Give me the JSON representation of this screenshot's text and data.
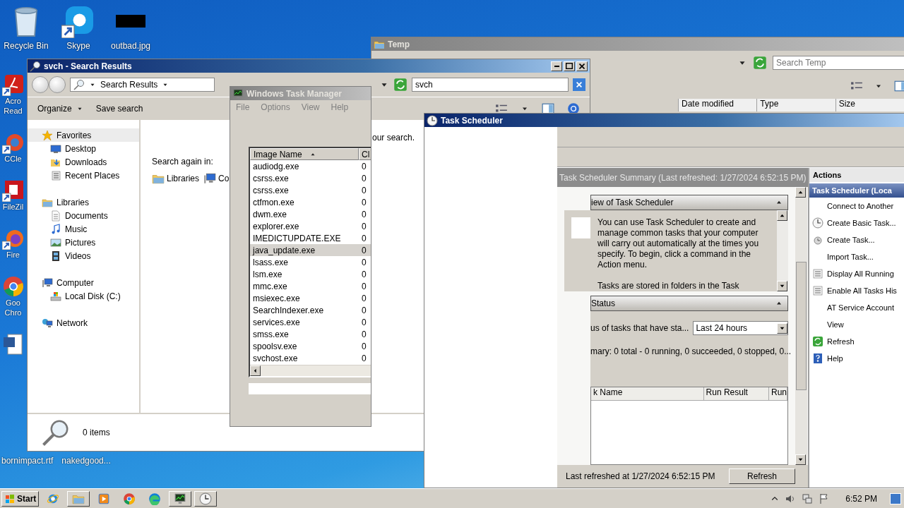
{
  "desktop": {
    "top_icons": [
      {
        "kind": "recycle",
        "label": "Recycle Bin"
      },
      {
        "kind": "app",
        "label": "Skype"
      },
      {
        "kind": "image",
        "label": "outbad.jpg"
      }
    ],
    "side_icons": [
      {
        "kind": "pdf",
        "label": "Acro Read"
      },
      {
        "kind": "ccleaner",
        "label": "CCle"
      },
      {
        "kind": "filezilla",
        "label": "FileZil"
      },
      {
        "kind": "firefox",
        "label": "Fire"
      },
      {
        "kind": "chrome",
        "label": "Goo Chro"
      },
      {
        "kind": "word"
      }
    ],
    "bottom_labels": [
      "bornimpact.rtf",
      "nakedgood..."
    ]
  },
  "temp_window": {
    "title": "Temp",
    "search": {
      "placeholder": "Search Temp"
    },
    "columns": [
      "Date modified",
      "Type",
      "Size"
    ]
  },
  "search_window": {
    "title": "svch - Search Results",
    "address": "Search Results",
    "search": {
      "value": "svch"
    },
    "toolbar": [
      {
        "label": "Organize",
        "menu": true
      },
      {
        "label": "Save search",
        "menu": false
      }
    ],
    "nav": [
      {
        "kind": "star",
        "label": "Favorites",
        "selected": true,
        "children": [
          {
            "kind": "desktop",
            "label": "Desktop",
            "selected": false
          },
          {
            "kind": "download",
            "label": "Downloads",
            "selected": false
          },
          {
            "kind": "recent",
            "label": "Recent Places",
            "selected": false
          }
        ]
      },
      {
        "kind": "library",
        "label": "Libraries",
        "selected": false,
        "children": [
          {
            "kind": "doc",
            "label": "Documents",
            "selected": false
          },
          {
            "kind": "music",
            "label": "Music",
            "selected": false
          },
          {
            "kind": "picture",
            "label": "Pictures",
            "selected": false
          },
          {
            "kind": "video",
            "label": "Videos",
            "selected": false
          }
        ]
      },
      {
        "kind": "computer",
        "label": "Computer",
        "selected": false,
        "children": [
          {
            "kind": "drive",
            "label": "Local Disk (C:)",
            "selected": false
          }
        ]
      },
      {
        "kind": "network",
        "label": "Network",
        "selected": false
      }
    ],
    "message": "our search.",
    "search_again": {
      "label": "Search again in:",
      "locations": [
        {
          "kind": "library",
          "label": "Libraries"
        },
        {
          "kind": "computer",
          "label": "Co"
        }
      ]
    },
    "status": "0 items"
  },
  "task_manager": {
    "title": "Windows Task Manager",
    "menu": [
      "File",
      "Options",
      "View",
      "Help"
    ],
    "columns": [
      "Image Name",
      "Cl"
    ],
    "rows": [
      {
        "name": "audiodg.exe",
        "column_2": "0",
        "selected": false
      },
      {
        "name": "csrss.exe",
        "column_2": "0",
        "selected": false
      },
      {
        "name": "csrss.exe",
        "column_2": "0",
        "selected": false
      },
      {
        "name": "ctfmon.exe",
        "column_2": "0",
        "selected": false
      },
      {
        "name": "dwm.exe",
        "column_2": "0",
        "selected": false
      },
      {
        "name": "explorer.exe",
        "column_2": "0",
        "selected": false
      },
      {
        "name": "IMEDICTUPDATE.EXE",
        "column_2": "0",
        "selected": false
      },
      {
        "name": "java_update.exe",
        "column_2": "0",
        "selected": true
      },
      {
        "name": "lsass.exe",
        "column_2": "0",
        "selected": false
      },
      {
        "name": "lsm.exe",
        "column_2": "0",
        "selected": false
      },
      {
        "name": "mmc.exe",
        "column_2": "0",
        "selected": false
      },
      {
        "name": "msiexec.exe",
        "column_2": "0",
        "selected": false
      },
      {
        "name": "SearchIndexer.exe",
        "column_2": "0",
        "selected": false
      },
      {
        "name": "services.exe",
        "column_2": "0",
        "selected": false
      },
      {
        "name": "smss.exe",
        "column_2": "0",
        "selected": false
      },
      {
        "name": "spoolsv.exe",
        "column_2": "0",
        "selected": false
      },
      {
        "name": "svchost.exe",
        "column_2": "0",
        "selected": false
      }
    ]
  },
  "task_scheduler": {
    "title": "Task Scheduler",
    "summary_title": "Task Scheduler Summary (Last refreshed: 1/27/2024 6:52:15 PM)",
    "overview": {
      "title": "iew of Task Scheduler",
      "text": "You can use Task Scheduler to create and manage common tasks that your computer will carry out automatically at the times you specify. To begin, click a command in the Action menu.",
      "text_2": "Tasks are stored in folders in the Task"
    },
    "status": {
      "title": "Status",
      "filter_label": "us of tasks that have sta...",
      "filter": "Last 24 hours",
      "summary": "mary: 0 total - 0 running, 0 succeeded, 0 stopped, 0...",
      "columns": [
        "k Name",
        "Run Result",
        "Run"
      ]
    },
    "footer": "Last refreshed at 1/27/2024 6:52:15 PM",
    "refresh_button": "Refresh",
    "actions": {
      "title": "Actions",
      "section": "Task Scheduler (Loca",
      "items": [
        {
          "label": "Connect to Another"
        },
        {
          "kind": "clock",
          "label": "Create Basic Task..."
        },
        {
          "kind": "task",
          "label": "Create Task..."
        },
        {
          "label": "Import Task..."
        },
        {
          "kind": "list",
          "label": "Display All Running"
        },
        {
          "kind": "list",
          "label": "Enable All Tasks His"
        },
        {
          "label": "AT Service Account"
        },
        {
          "label": "View"
        },
        {
          "kind": "refresh",
          "label": "Refresh"
        },
        {
          "kind": "help",
          "label": "Help"
        }
      ]
    }
  },
  "taskbar": {
    "start": "Start",
    "apps": [
      {
        "kind": "ie",
        "open": false
      },
      {
        "kind": "folder",
        "open": true
      },
      {
        "kind": "media",
        "open": false
      },
      {
        "kind": "chrome",
        "open": false
      },
      {
        "kind": "edge",
        "open": false
      },
      {
        "kind": "taskmgr",
        "open": true
      },
      {
        "kind": "clock",
        "open": true
      }
    ],
    "time": "6:52 PM"
  }
}
